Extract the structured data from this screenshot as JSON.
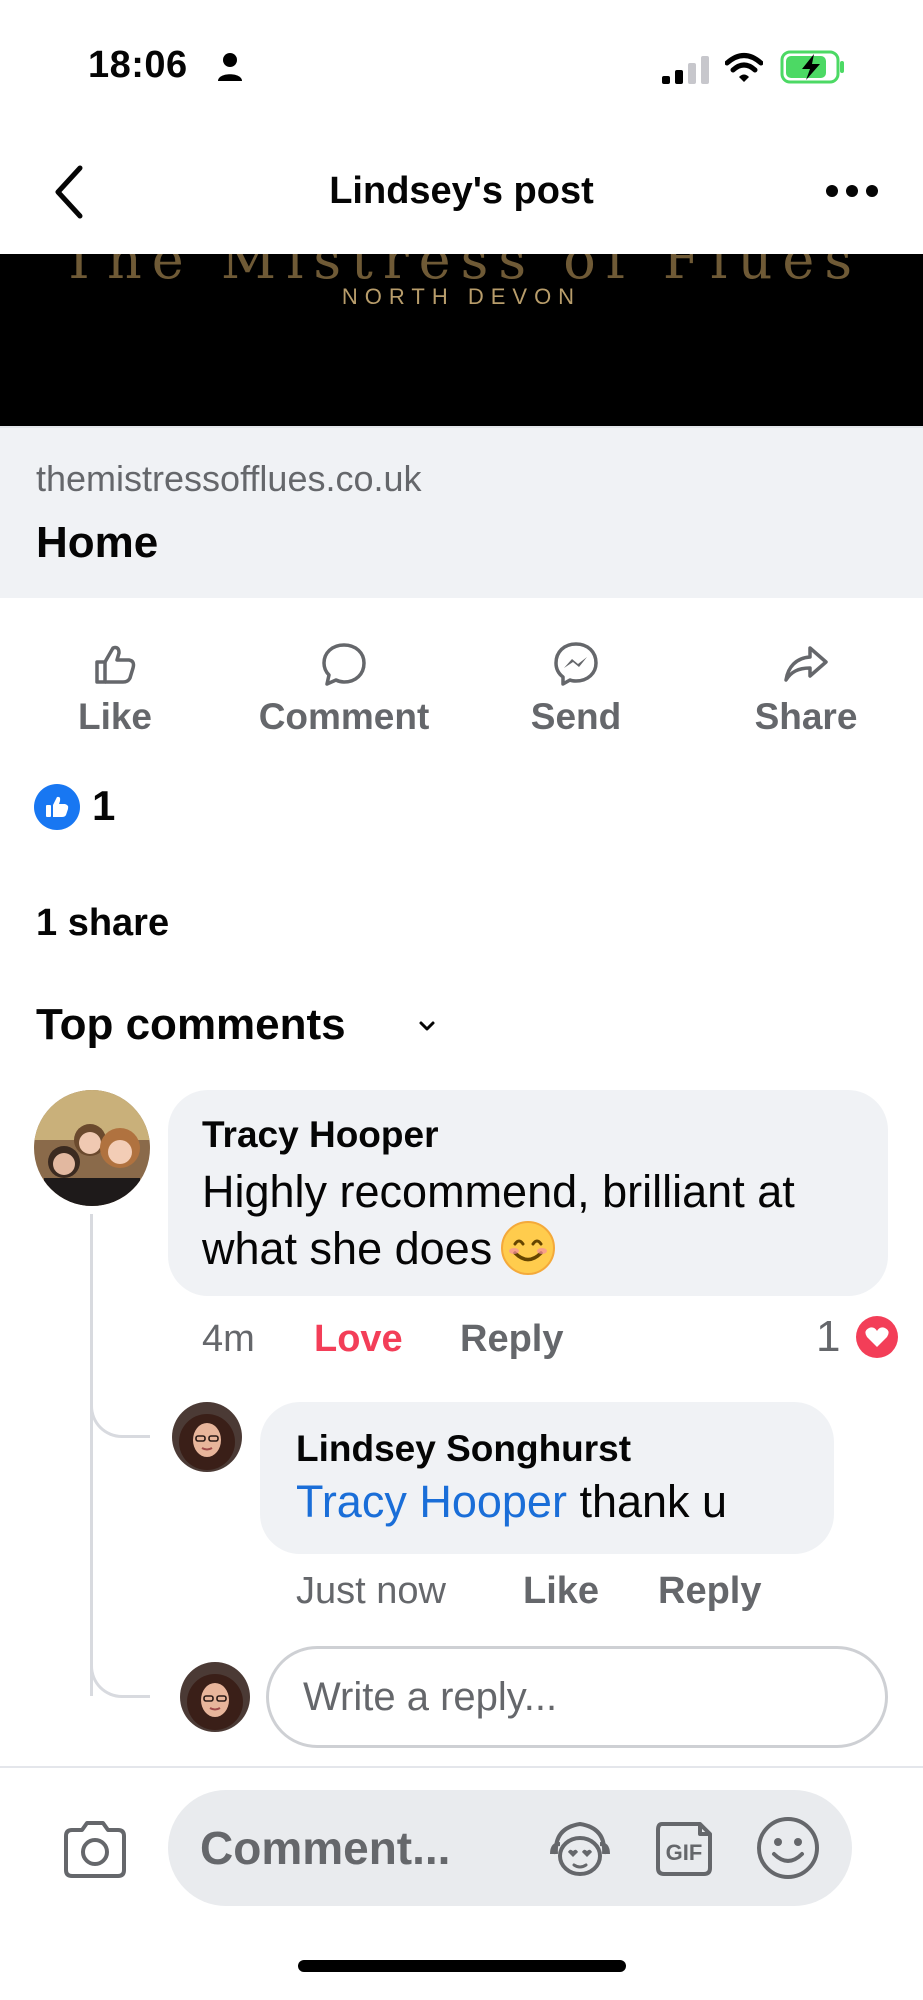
{
  "status_bar": {
    "time": "18:06"
  },
  "header": {
    "title": "Lindsey's post"
  },
  "link_preview": {
    "brand_name": "The Mistress of Flues",
    "brand_subtitle": "NORTH DEVON",
    "domain": "themistressofflues.co.uk",
    "title": "Home"
  },
  "actions": {
    "like": "Like",
    "comment": "Comment",
    "send": "Send",
    "share": "Share"
  },
  "reactions": {
    "like_count": "1",
    "shares": "1 share"
  },
  "comments_section": {
    "sort_label": "Top comments"
  },
  "comment": {
    "author": "Tracy Hooper",
    "text": "Highly recommend, brilliant at what she does",
    "time": "4m",
    "reaction_label": "Love",
    "reply_label": "Reply",
    "reaction_count": "1"
  },
  "reply": {
    "author": "Lindsey Songhurst",
    "mention": "Tracy Hooper",
    "text": " thank u",
    "time": "Just now",
    "like_label": "Like",
    "reply_label": "Reply"
  },
  "reply_input": {
    "placeholder": "Write a reply..."
  },
  "composer": {
    "placeholder": "Comment..."
  },
  "colors": {
    "brand_blue": "#1877f2",
    "mention_blue": "#1a6ed8",
    "love_red": "#f33e58",
    "bubble_gray": "#f0f2f5",
    "secondary_text": "#65676b"
  }
}
